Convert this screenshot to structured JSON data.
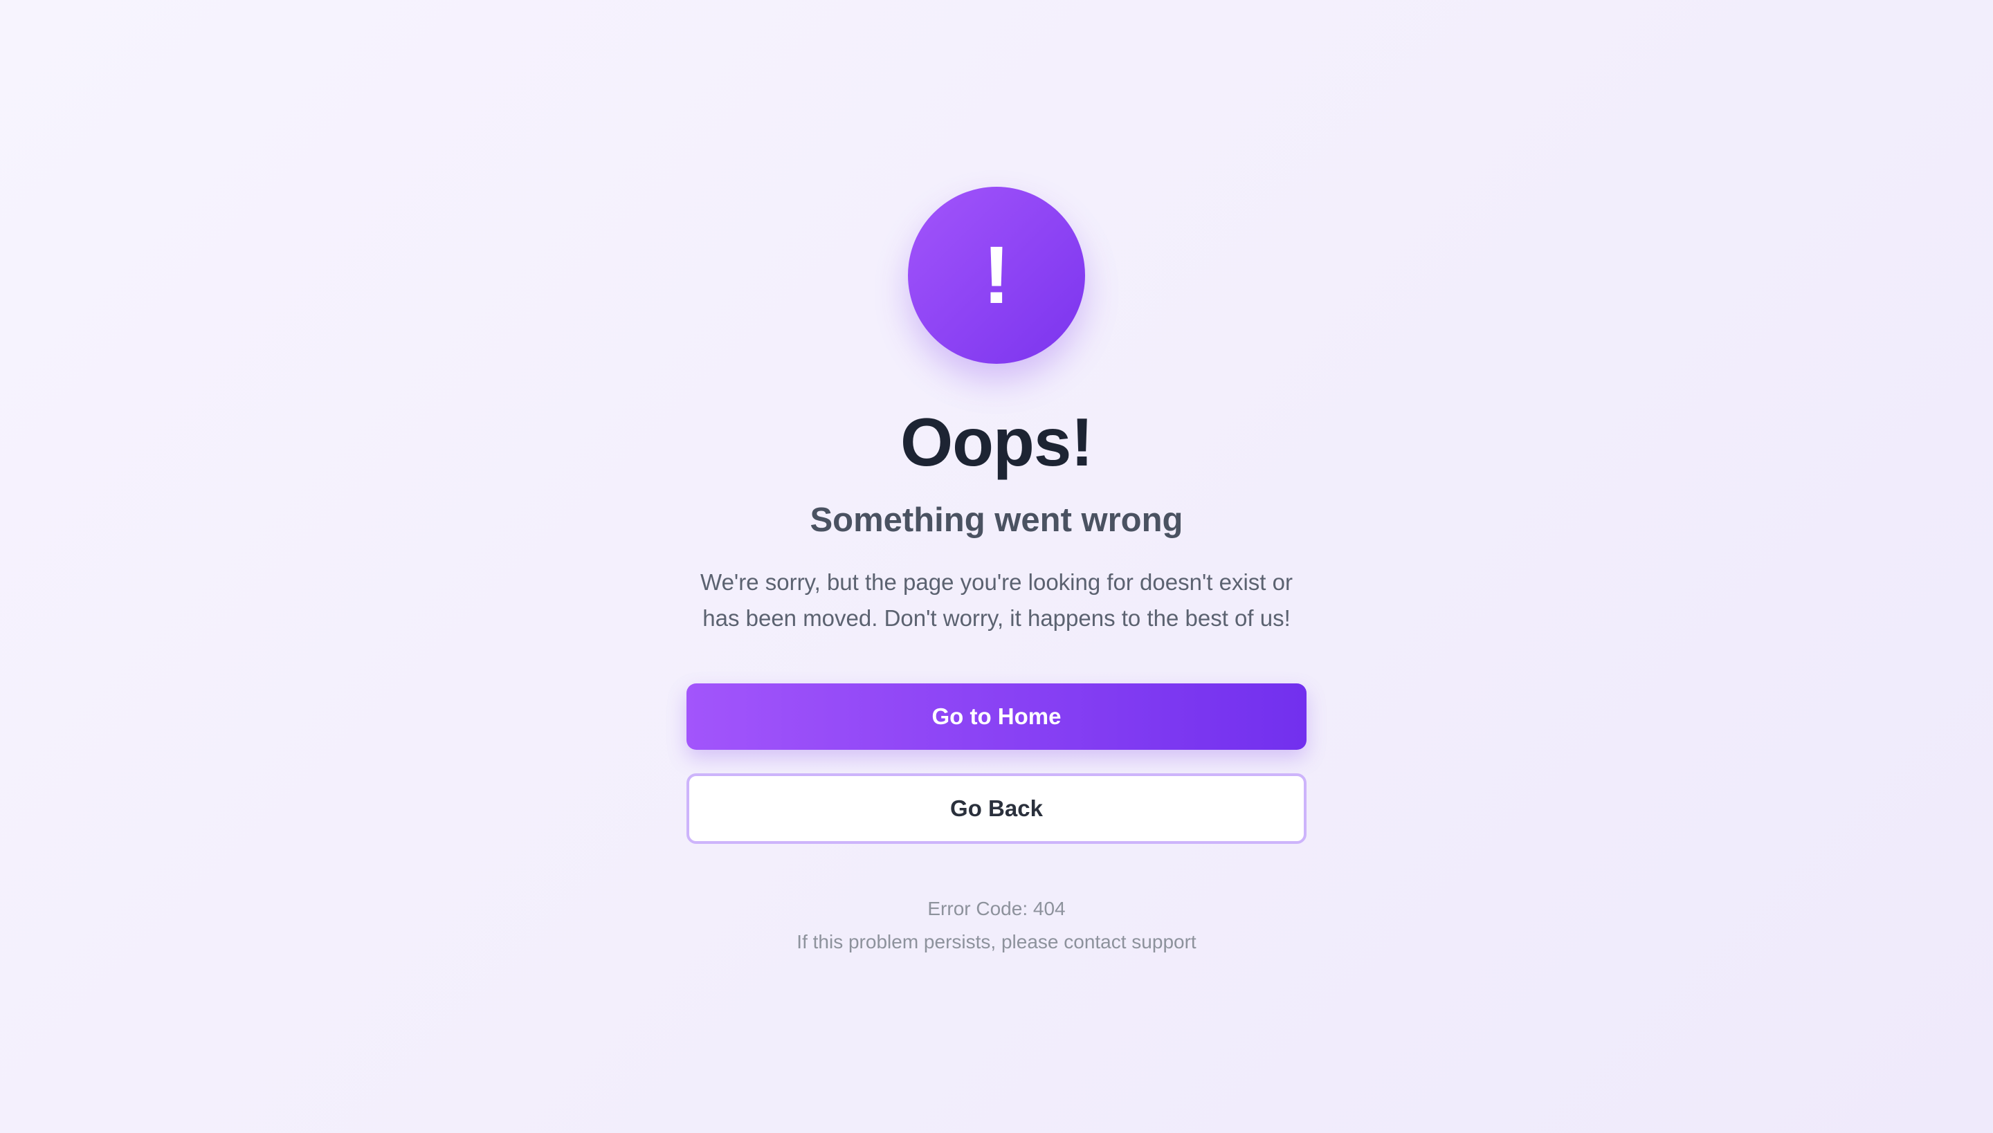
{
  "error": {
    "icon": "exclamation-icon",
    "icon_glyph": "!",
    "title": "Oops!",
    "subtitle": "Something went wrong",
    "message": "We're sorry, but the page you're looking for doesn't exist or has been moved. Don't worry, it happens to the best of us!",
    "code_text": "Error Code: 404",
    "support_text": "If this problem persists, please contact support"
  },
  "actions": {
    "home_label": "Go to Home",
    "back_label": "Go Back"
  },
  "colors": {
    "accent_start": "#a255fb",
    "accent_end": "#7230ee",
    "heading": "#1d2433",
    "secondary_border": "#cdb4fb"
  }
}
